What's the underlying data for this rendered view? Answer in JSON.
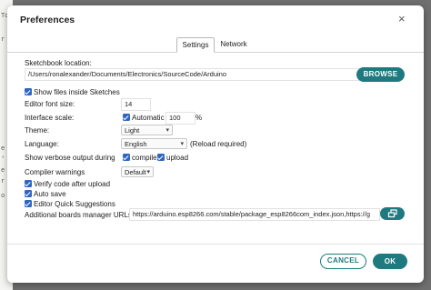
{
  "background": {
    "fragments": [
      "To",
      "r",
      "e",
      "'",
      "e",
      "r",
      "o"
    ]
  },
  "dialog": {
    "title": "Preferences",
    "close_symbol": "×",
    "tabs": [
      {
        "label": "Settings",
        "active": true
      },
      {
        "label": "Network",
        "active": false
      }
    ]
  },
  "settings": {
    "sketchbook_label": "Sketchbook location:",
    "sketchbook_value": "/Users/ronalexander/Documents/Electronics/SourceCode/Arduino",
    "browse_label": "BROWSE",
    "show_files_label": "Show files inside Sketches",
    "editor_font_size_label": "Editor font size:",
    "editor_font_size_value": "14",
    "interface_scale_label": "Interface scale:",
    "automatic_label": "Automatic",
    "scale_value": "100",
    "scale_unit": "%",
    "theme_label": "Theme:",
    "theme_value": "Light",
    "language_label": "Language:",
    "language_value": "English",
    "reload_note": "(Reload required)",
    "verbose_label": "Show verbose output during",
    "compile_label": "compile",
    "upload_label": "upload",
    "compiler_warnings_label": "Compiler warnings",
    "compiler_warnings_value": "Default",
    "verify_label": "Verify code after upload",
    "auto_save_label": "Auto save",
    "quick_suggestions_label": "Editor Quick Suggestions",
    "boards_url_label": "Additional boards manager URLs:",
    "boards_url_value": "https://arduino.esp8266.com/stable/package_esp8266com_index.json,https://g"
  },
  "footer": {
    "cancel_label": "CANCEL",
    "ok_label": "OK"
  },
  "colors": {
    "accent": "#1f7a7f",
    "checkbox": "#2f66c2",
    "overlay": "#6f6f6f"
  }
}
